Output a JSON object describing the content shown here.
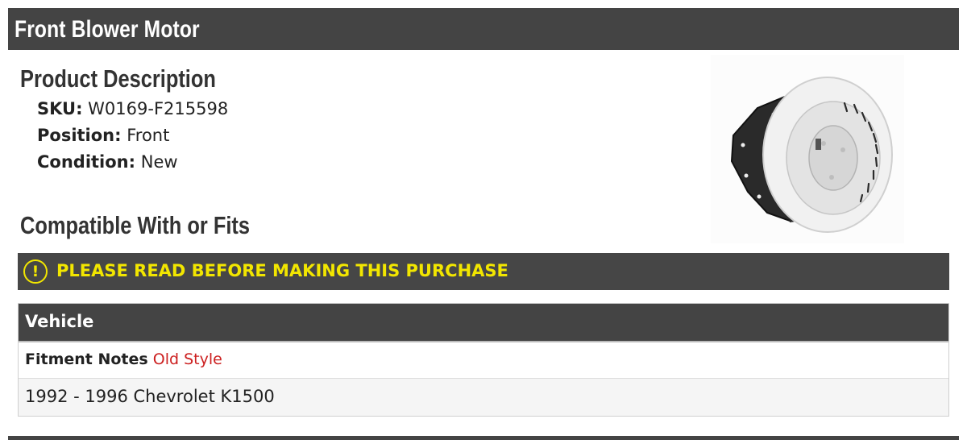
{
  "header": {
    "title": "Front Blower Motor"
  },
  "description": {
    "heading": "Product Description",
    "sku": {
      "label": "SKU:",
      "value": "W0169-F215598"
    },
    "position": {
      "label": "Position:",
      "value": "Front"
    },
    "condition": {
      "label": "Condition:",
      "value": "New"
    }
  },
  "compatibility": {
    "heading": "Compatible With or Fits"
  },
  "warning": {
    "icon": "exclamation-circle-icon",
    "glyph": "!",
    "text": "PLEASE READ BEFORE MAKING THIS PURCHASE"
  },
  "fitment_table": {
    "column_header": "Vehicle",
    "notes_label": "Fitment Notes",
    "notes_value": "Old Style",
    "rows": [
      "1992 - 1996 Chevrolet K1500"
    ]
  },
  "colors": {
    "header_bg": "#444444",
    "warning_text": "#f2e600",
    "notes_value": "#cc1f1f"
  },
  "image": {
    "subject": "blower-motor-image"
  }
}
